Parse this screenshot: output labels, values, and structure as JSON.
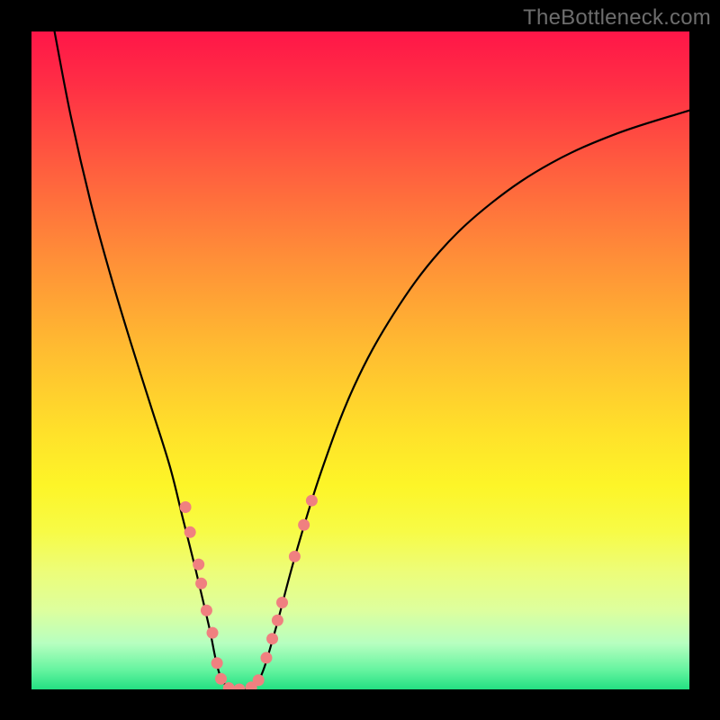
{
  "watermark": "TheBottleneck.com",
  "chart_data": {
    "type": "line",
    "title": "",
    "xlabel": "",
    "ylabel": "",
    "xlim": [
      0,
      100
    ],
    "ylim": [
      0,
      100
    ],
    "grid": false,
    "series": [
      {
        "name": "curve",
        "color": "#000000",
        "x": [
          3.5,
          6,
          9,
          12,
          15,
          18,
          21,
          23,
          25,
          27,
          28.6,
          30.6,
          33.2,
          34.9,
          37,
          40,
          44,
          49,
          55,
          62,
          70,
          79,
          89,
          100
        ],
        "y": [
          100,
          87,
          74,
          63,
          53,
          43.5,
          34,
          26,
          18,
          9.5,
          2.3,
          0,
          0.2,
          2.1,
          8.8,
          20,
          33,
          46,
          57,
          66.5,
          74,
          80,
          84.5,
          88
        ]
      }
    ],
    "markers": [
      {
        "name": "dots",
        "color": "#f08080",
        "radius_px": 6.5,
        "points": [
          {
            "x": 23.4,
            "y": 27.7
          },
          {
            "x": 24.1,
            "y": 23.9
          },
          {
            "x": 25.4,
            "y": 19.0
          },
          {
            "x": 25.8,
            "y": 16.1
          },
          {
            "x": 26.6,
            "y": 12.0
          },
          {
            "x": 27.5,
            "y": 8.6
          },
          {
            "x": 28.2,
            "y": 4.0
          },
          {
            "x": 28.8,
            "y": 1.6
          },
          {
            "x": 30.0,
            "y": 0.2
          },
          {
            "x": 31.6,
            "y": 0.0
          },
          {
            "x": 33.4,
            "y": 0.3
          },
          {
            "x": 34.5,
            "y": 1.4
          },
          {
            "x": 35.7,
            "y": 4.8
          },
          {
            "x": 36.6,
            "y": 7.7
          },
          {
            "x": 37.4,
            "y": 10.5
          },
          {
            "x": 38.1,
            "y": 13.2
          },
          {
            "x": 40.0,
            "y": 20.2
          },
          {
            "x": 41.4,
            "y": 25.0
          },
          {
            "x": 42.6,
            "y": 28.7
          }
        ]
      }
    ]
  }
}
